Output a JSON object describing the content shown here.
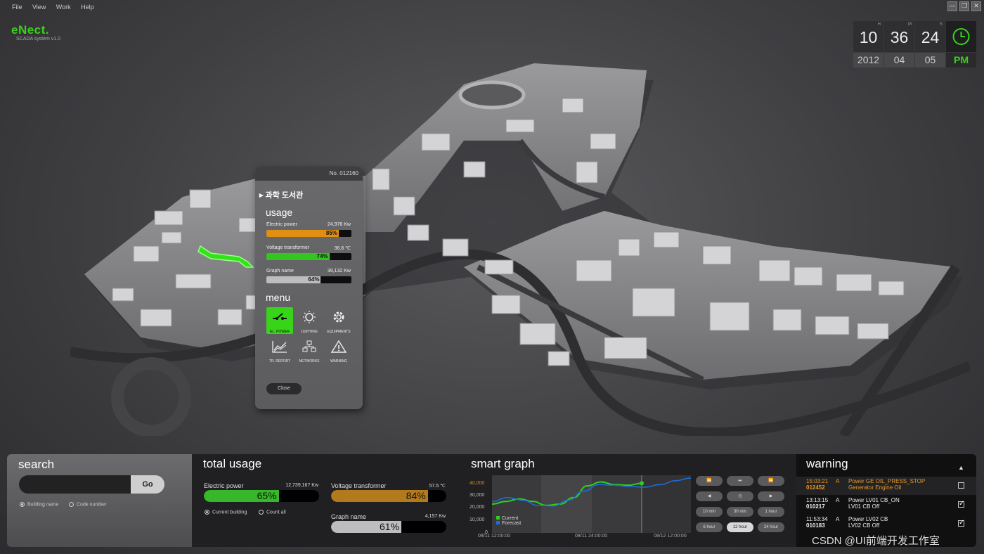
{
  "menubar": {
    "items": [
      "File",
      "View",
      "Work",
      "Help"
    ]
  },
  "window_buttons": [
    "—",
    "❐",
    "✕"
  ],
  "app": {
    "name": "eNect.",
    "subtitle": "SCADA system v1.0"
  },
  "clock": {
    "hour": "10",
    "minute": "36",
    "second": "24",
    "h_label": "H",
    "m_label": "M",
    "s_label": "S",
    "year": "2012",
    "month": "04",
    "day": "05",
    "ampm": "PM",
    "accent": "#3ad21a"
  },
  "popup": {
    "number": "No. 012160",
    "building": "과학 도서관",
    "usage_title": "usage",
    "bars": [
      {
        "label": "Electric power",
        "value": "24,976 Kw",
        "percent": 85,
        "percent_label": "85%",
        "color": "#e08f12"
      },
      {
        "label": "Voltage transformer",
        "value": "36.8 ℃",
        "percent": 74,
        "percent_label": "74%",
        "color": "#33c61e"
      },
      {
        "label": "Graph name",
        "value": "39,132 Kw",
        "percent": 64,
        "percent_label": "64%",
        "color": "#bdbdbd"
      }
    ],
    "menu_title": "menu",
    "menu_items": [
      {
        "label": "EL. POWER",
        "icon": "power-switch-icon",
        "active": true
      },
      {
        "label": "LIGHTING",
        "icon": "lightbulb-icon"
      },
      {
        "label": "EQUIPMENTS",
        "icon": "gear-icon"
      },
      {
        "label": "TR. REPORT",
        "icon": "chart-icon"
      },
      {
        "label": "NETWORKS",
        "icon": "network-icon"
      },
      {
        "label": "WARNING",
        "icon": "warning-icon"
      }
    ],
    "close_label": "Close"
  },
  "search": {
    "title": "search",
    "go_label": "Go",
    "options": [
      "Building name",
      "Code number"
    ],
    "selected": "Building name"
  },
  "total_usage": {
    "title": "total usage",
    "bars": [
      {
        "label": "Electric power",
        "value": "12,739,167 Kw",
        "percent": 65,
        "percent_label": "65%",
        "color": "#36b82a"
      },
      {
        "label": "Voltage transformer",
        "value": "57.5 ℃",
        "percent": 84,
        "percent_label": "84%",
        "color": "#b27a1c"
      },
      {
        "label": "Graph name",
        "value": "4,157 Kw",
        "percent": 61,
        "percent_label": "61%",
        "color": "#bdbdbd"
      }
    ],
    "options": [
      "Current building",
      "Count all"
    ],
    "selected": "Current building"
  },
  "smart_graph": {
    "title": "smart graph",
    "legend": [
      {
        "name": "Current",
        "color": "#2ed11c"
      },
      {
        "name": "Forecast",
        "color": "#1c6de0"
      }
    ],
    "controls": [
      "⏪",
      "⏭",
      "⏩",
      "◀",
      "◷",
      "▶"
    ],
    "intervals": [
      "10 min",
      "30 min",
      "1 hour",
      "6 hour",
      "12 hour",
      "24 hour"
    ],
    "selected_interval": "12 hour"
  },
  "chart_data": {
    "type": "line",
    "y_ticks": [
      "40,000",
      "30,000",
      "20,000",
      "10,000",
      "0"
    ],
    "x_ticks": [
      "08/11 12:00:00",
      "08/11 24:00:00",
      "08/12 12:00:00"
    ],
    "ylim": [
      0,
      40000
    ],
    "series": [
      {
        "name": "Current",
        "values": [
          20000,
          22000,
          24000,
          22000,
          19000,
          20000,
          25000,
          34000,
          37000,
          35000,
          34500,
          36000
        ]
      },
      {
        "name": "Forecast",
        "values": [
          22000,
          25000,
          23000,
          19000,
          18500,
          23000,
          30000,
          35000,
          34500,
          33500,
          33000,
          35000,
          38000,
          40000
        ]
      }
    ]
  },
  "warning": {
    "title": "warning",
    "rows": [
      {
        "time": "15:03:21",
        "level": "A",
        "code": "012452",
        "line1": "Power GE OIL_PRESS_STOP",
        "line2": "Generator Engine  Oil",
        "checked": false,
        "color": "#e8962a"
      },
      {
        "time": "13:13:15",
        "level": "A",
        "code": "010217",
        "line1": "Power LV01 CB_ON",
        "line2": "LV01 CB Off",
        "checked": true,
        "color": "#eeeeee"
      },
      {
        "time": "11:53:34",
        "level": "A",
        "code": "010183",
        "line1": "Power LV02 CB",
        "line2": "LV02 CB Off",
        "checked": true,
        "color": "#eeeeee"
      }
    ]
  },
  "watermark": "CSDN @UI前端开发工作室"
}
